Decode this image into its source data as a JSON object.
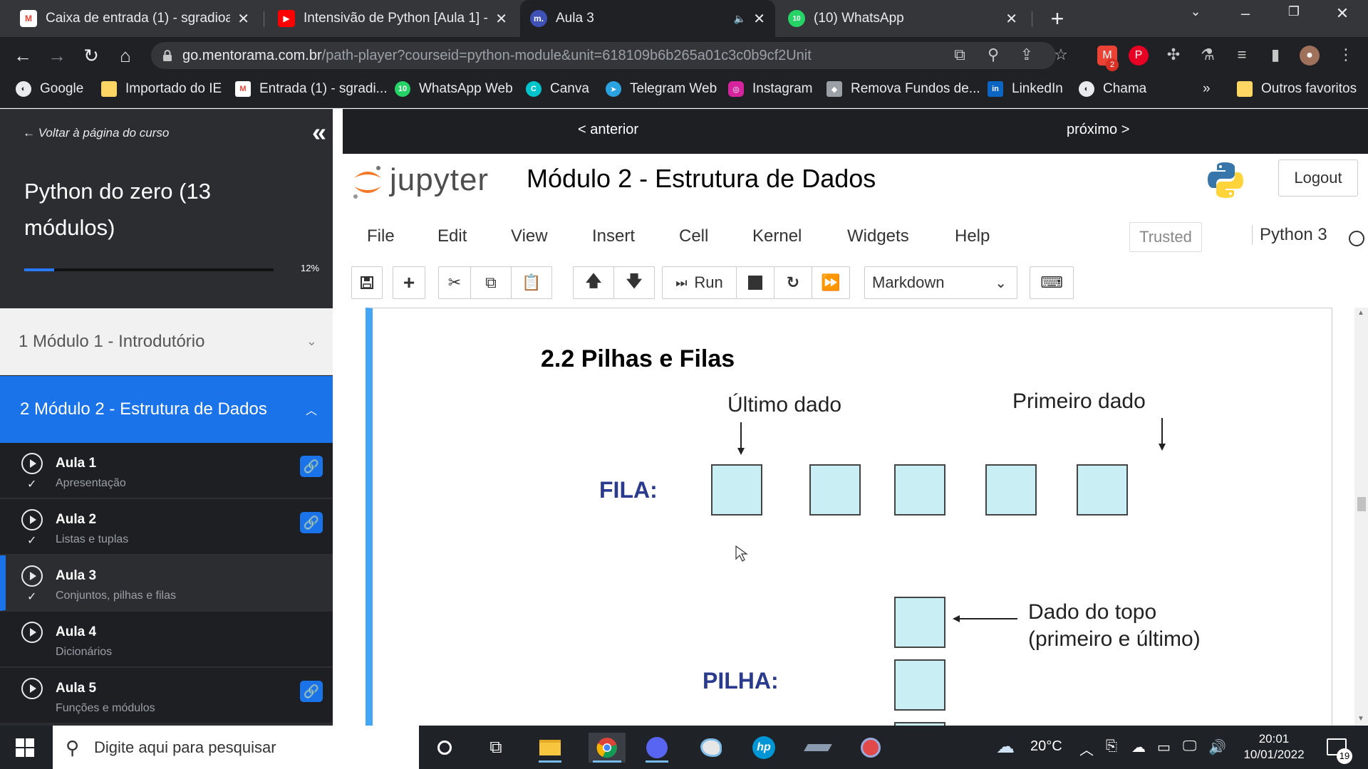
{
  "browser": {
    "tabs": [
      {
        "title": "Caixa de entrada (1) - sgradioativ",
        "icon": "gmail-icon",
        "active": false
      },
      {
        "title": "Intensivão de Python [Aula 1] - Y",
        "icon": "youtube-icon",
        "active": false
      },
      {
        "title": "Aula 3",
        "icon": "mentorama-icon",
        "active": true,
        "muted": true
      },
      {
        "title": "(10) WhatsApp",
        "icon": "whatsapp-icon",
        "active": false,
        "badge": "10"
      }
    ],
    "url_host": "go.mentorama.com.br",
    "url_path": "/path-player?courseid=python-module&unit=618109b6b265a01c3c0b9cf2Unit",
    "extension_badge": "2",
    "bookmarks": [
      {
        "label": "Google"
      },
      {
        "label": "Importado do IE"
      },
      {
        "label": "Entrada (1) - sgradi..."
      },
      {
        "label": "WhatsApp Web"
      },
      {
        "label": "Canva"
      },
      {
        "label": "Telegram Web"
      },
      {
        "label": "Instagram"
      },
      {
        "label": "Remova Fundos de..."
      },
      {
        "label": "LinkedIn"
      },
      {
        "label": "Chama"
      }
    ],
    "bookmarks_overflow": "»",
    "other_bookmarks": "Outros favoritos"
  },
  "sidebar": {
    "back_label": "← Voltar à página do curso",
    "course_title": "Python do zero (13 módulos)",
    "progress_pct": "12%",
    "progress_value": 0.12,
    "module1": "1 Módulo 1 - Introdutório",
    "module2": "2 Módulo 2 - Estrutura de Dados",
    "lessons": [
      {
        "title": "Aula 1",
        "subtitle": "Apresentação",
        "attachment": true
      },
      {
        "title": "Aula 2",
        "subtitle": "Listas e tuplas",
        "attachment": true
      },
      {
        "title": "Aula 3",
        "subtitle": "Conjuntos, pilhas e filas",
        "attachment": false,
        "current": true
      },
      {
        "title": "Aula 4",
        "subtitle": "Dicionários",
        "attachment": false
      },
      {
        "title": "Aula 5",
        "subtitle": "Funções e módulos",
        "attachment": true
      }
    ]
  },
  "content_nav": {
    "prev": "< anterior",
    "next": "próximo >"
  },
  "jupyter": {
    "logo_text": "jupyter",
    "notebook_title": "Módulo 2 - Estrutura de Dados",
    "logout": "Logout",
    "menu": [
      "File",
      "Edit",
      "View",
      "Insert",
      "Cell",
      "Kernel",
      "Widgets",
      "Help"
    ],
    "trusted": "Trusted",
    "kernel": "Python 3",
    "run_label": "Run",
    "cell_type": "Markdown"
  },
  "cell": {
    "heading": "2.2 Pilhas e Filas",
    "label_last": "Último dado",
    "label_first": "Primeiro dado",
    "fila": "FILA:",
    "pilha": "PILHA:",
    "top_label_1": "Dado do topo",
    "top_label_2": "(primeiro e último)",
    "box_fill": "#c9eef3"
  },
  "taskbar": {
    "search_placeholder": "Digite aqui para pesquisar",
    "weather": "20°C",
    "time": "20:01",
    "date": "10/01/2022",
    "notifications": "19"
  }
}
